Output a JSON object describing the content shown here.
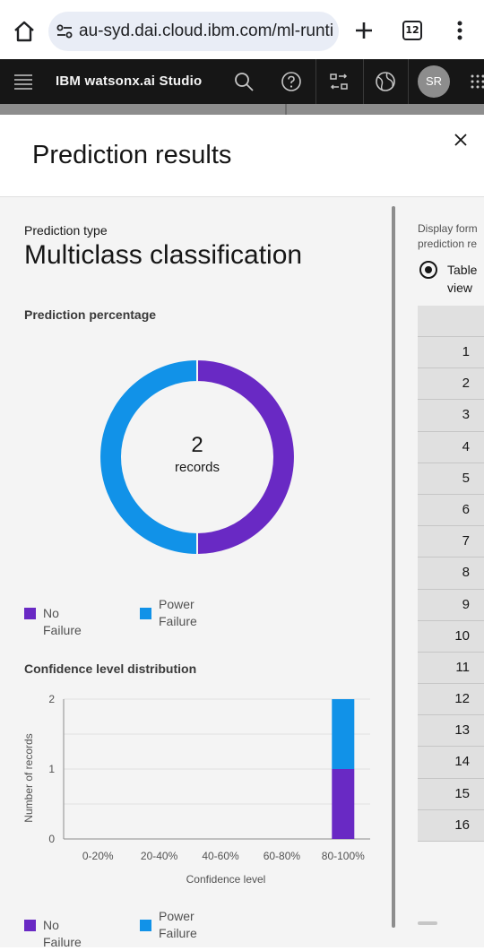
{
  "browser": {
    "url": "au-syd.dai.cloud.ibm.com/ml-runtim",
    "tab_count": "12",
    "icons": [
      "home-icon",
      "site-settings-icon",
      "new-tab-icon",
      "tab-switcher-icon",
      "more-menu-icon"
    ]
  },
  "header": {
    "brand": "IBM watsonx.ai Studio",
    "avatar_initials": "SR",
    "icons": [
      "hamburger-icon",
      "search-icon",
      "help-icon",
      "switch-icon",
      "globe-icon",
      "app-switcher-icon"
    ]
  },
  "modal": {
    "title": "Prediction results",
    "prediction_type_label": "Prediction type",
    "prediction_type_value": "Multiclass classification",
    "percentage_title": "Prediction percentage",
    "donut": {
      "count": "2",
      "unit": "records"
    },
    "legend": [
      {
        "label": "No Failure",
        "color": "#6929c4"
      },
      {
        "label": "Power Failure",
        "color": "#1192e8"
      }
    ],
    "confidence_title": "Confidence level distribution",
    "right": {
      "display_label": "Display form\nprediction re",
      "radio_label": "Table\nview",
      "rows": [
        "1",
        "2",
        "3",
        "4",
        "5",
        "6",
        "7",
        "8",
        "9",
        "10",
        "11",
        "12",
        "13",
        "14",
        "15",
        "16"
      ]
    }
  },
  "chart_data": [
    {
      "type": "pie",
      "title": "Prediction percentage",
      "categories": [
        "No Failure",
        "Power Failure"
      ],
      "values": [
        1,
        1
      ],
      "colors": [
        "#6929c4",
        "#1192e8"
      ],
      "center_label": "2 records"
    },
    {
      "type": "bar",
      "stacked": true,
      "title": "Confidence level distribution",
      "xlabel": "Confidence level",
      "ylabel": "Number of records",
      "categories": [
        "0-20%",
        "20-40%",
        "40-60%",
        "60-80%",
        "80-100%"
      ],
      "series": [
        {
          "name": "No Failure",
          "values": [
            0,
            0,
            0,
            0,
            1
          ],
          "color": "#6929c4"
        },
        {
          "name": "Power Failure",
          "values": [
            0,
            0,
            0,
            0,
            1
          ],
          "color": "#1192e8"
        }
      ],
      "yticks": [
        "0",
        "1",
        "2"
      ],
      "ylim": [
        0,
        2
      ],
      "grid": true
    }
  ]
}
